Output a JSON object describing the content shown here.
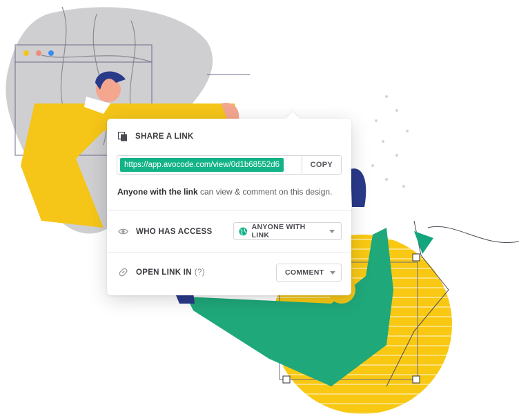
{
  "share": {
    "title": "SHARE A LINK",
    "link_url": "https://app.avocode.com/view/0d1b68552d6",
    "copy_label": "COPY",
    "desc_strong": "Anyone with the link",
    "desc_rest": " can view & comment on this design.",
    "access_label": "WHO HAS ACCESS",
    "access_value": "ANYONE WITH LINK",
    "open_label": "OPEN LINK IN",
    "open_hint": "(?)",
    "open_value": "COMMENT"
  },
  "colors": {
    "link_bg": "#12b386",
    "accent_yellow": "#f5c518",
    "accent_green": "#1fa87a"
  },
  "icons": [
    "copy-doc-icon",
    "eye-icon",
    "globe-icon",
    "link-icon",
    "chevron-down-icon"
  ]
}
